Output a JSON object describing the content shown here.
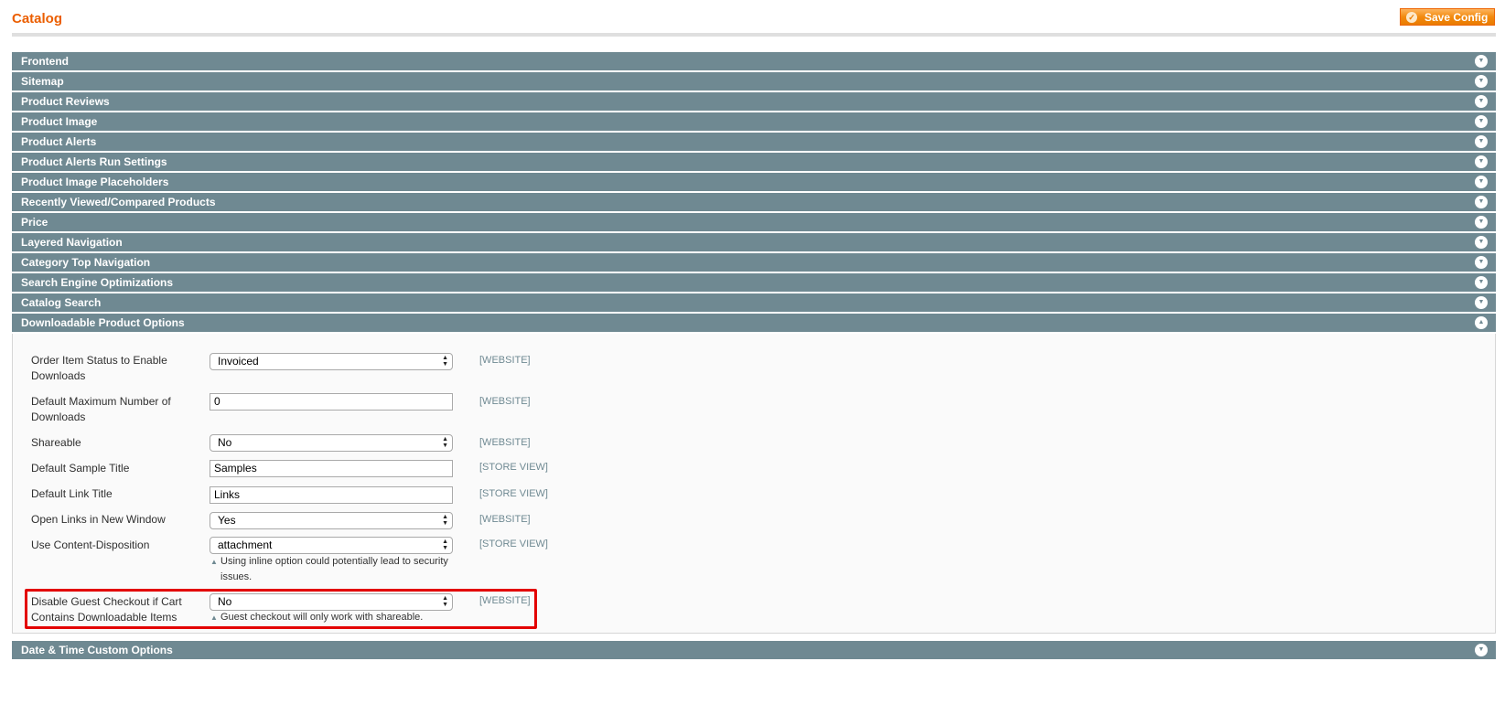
{
  "page": {
    "title": "Catalog",
    "save_label": "Save Config",
    "save_icon": "check-circle-icon"
  },
  "colors": {
    "accent": "#eb5e00",
    "section_header": "#6f8992",
    "highlight": "#e30000"
  },
  "sections": [
    {
      "label": "Frontend"
    },
    {
      "label": "Sitemap"
    },
    {
      "label": "Product Reviews"
    },
    {
      "label": "Product Image"
    },
    {
      "label": "Product Alerts"
    },
    {
      "label": "Product Alerts Run Settings"
    },
    {
      "label": "Product Image Placeholders"
    },
    {
      "label": "Recently Viewed/Compared Products"
    },
    {
      "label": "Price"
    },
    {
      "label": "Layered Navigation"
    },
    {
      "label": "Category Top Navigation"
    },
    {
      "label": "Search Engine Optimizations"
    },
    {
      "label": "Catalog Search"
    },
    {
      "label": "Downloadable Product Options"
    },
    {
      "label": "Date & Time Custom Options"
    }
  ],
  "downloadable": {
    "fields": [
      {
        "label": "Order Item Status to Enable Downloads",
        "value": "Invoiced",
        "scope": "[WEBSITE]"
      },
      {
        "label": "Default Maximum Number of Downloads",
        "value": "0",
        "scope": "[WEBSITE]"
      },
      {
        "label": "Shareable",
        "value": "No",
        "scope": "[WEBSITE]"
      },
      {
        "label": "Default Sample Title",
        "value": "Samples",
        "scope": "[STORE VIEW]"
      },
      {
        "label": "Default Link Title",
        "value": "Links",
        "scope": "[STORE VIEW]"
      },
      {
        "label": "Open Links in New Window",
        "value": "Yes",
        "scope": "[WEBSITE]"
      },
      {
        "label": "Use Content-Disposition",
        "value": "attachment",
        "scope": "[STORE VIEW]",
        "note": "Using inline option could potentially lead to security issues."
      },
      {
        "label": "Disable Guest Checkout if Cart Contains Downloadable Items",
        "value": "No",
        "scope": "[WEBSITE]",
        "note": "Guest checkout will only work with shareable."
      }
    ]
  }
}
